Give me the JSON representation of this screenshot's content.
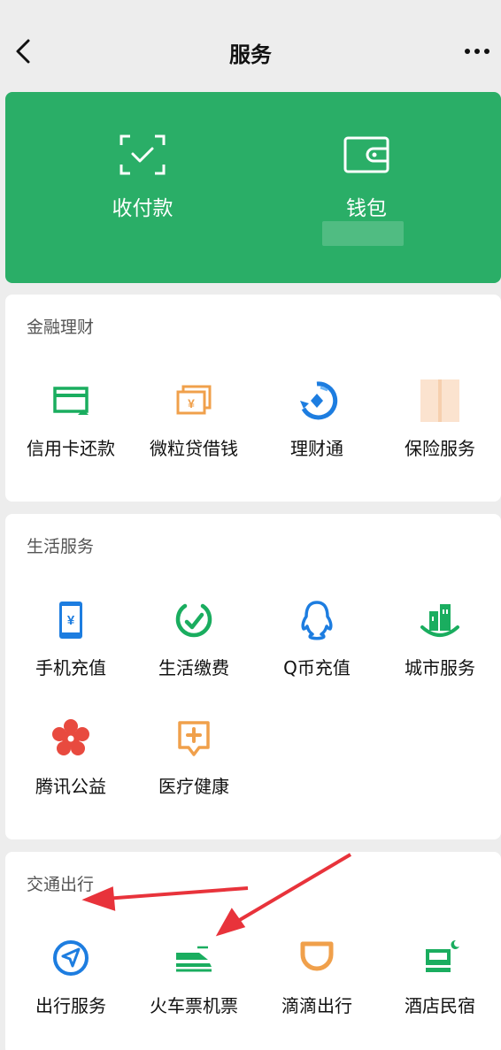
{
  "nav": {
    "title": "服务"
  },
  "pay": {
    "collect_label": "收付款",
    "wallet_label": "钱包"
  },
  "finance": {
    "title": "金融理财",
    "items": [
      {
        "label": "信用卡还款",
        "icon": "credit-card-repay-icon"
      },
      {
        "label": "微粒贷借钱",
        "icon": "weilidai-loan-icon"
      },
      {
        "label": "理财通",
        "icon": "licaitong-icon"
      },
      {
        "label": "保险服务",
        "icon": "insurance-icon"
      }
    ]
  },
  "life": {
    "title": "生活服务",
    "items": [
      {
        "label": "手机充值",
        "icon": "phone-topup-icon"
      },
      {
        "label": "生活缴费",
        "icon": "utility-bill-icon"
      },
      {
        "label": "Q币充值",
        "icon": "qq-coin-icon"
      },
      {
        "label": "城市服务",
        "icon": "city-service-icon"
      },
      {
        "label": "腾讯公益",
        "icon": "tencent-charity-icon"
      },
      {
        "label": "医疗健康",
        "icon": "medical-health-icon"
      }
    ]
  },
  "transport": {
    "title": "交通出行",
    "items": [
      {
        "label": "出行服务",
        "icon": "travel-service-icon"
      },
      {
        "label": "火车票机票",
        "icon": "train-flight-ticket-icon"
      },
      {
        "label": "滴滴出行",
        "icon": "didi-icon"
      },
      {
        "label": "酒店民宿",
        "icon": "hotel-icon"
      }
    ]
  },
  "colors": {
    "accent_green": "#2aae67",
    "icon_green": "#1aad5f",
    "icon_orange": "#f0a04b",
    "icon_blue": "#1d7de0",
    "annotation_red": "#e8333b"
  }
}
